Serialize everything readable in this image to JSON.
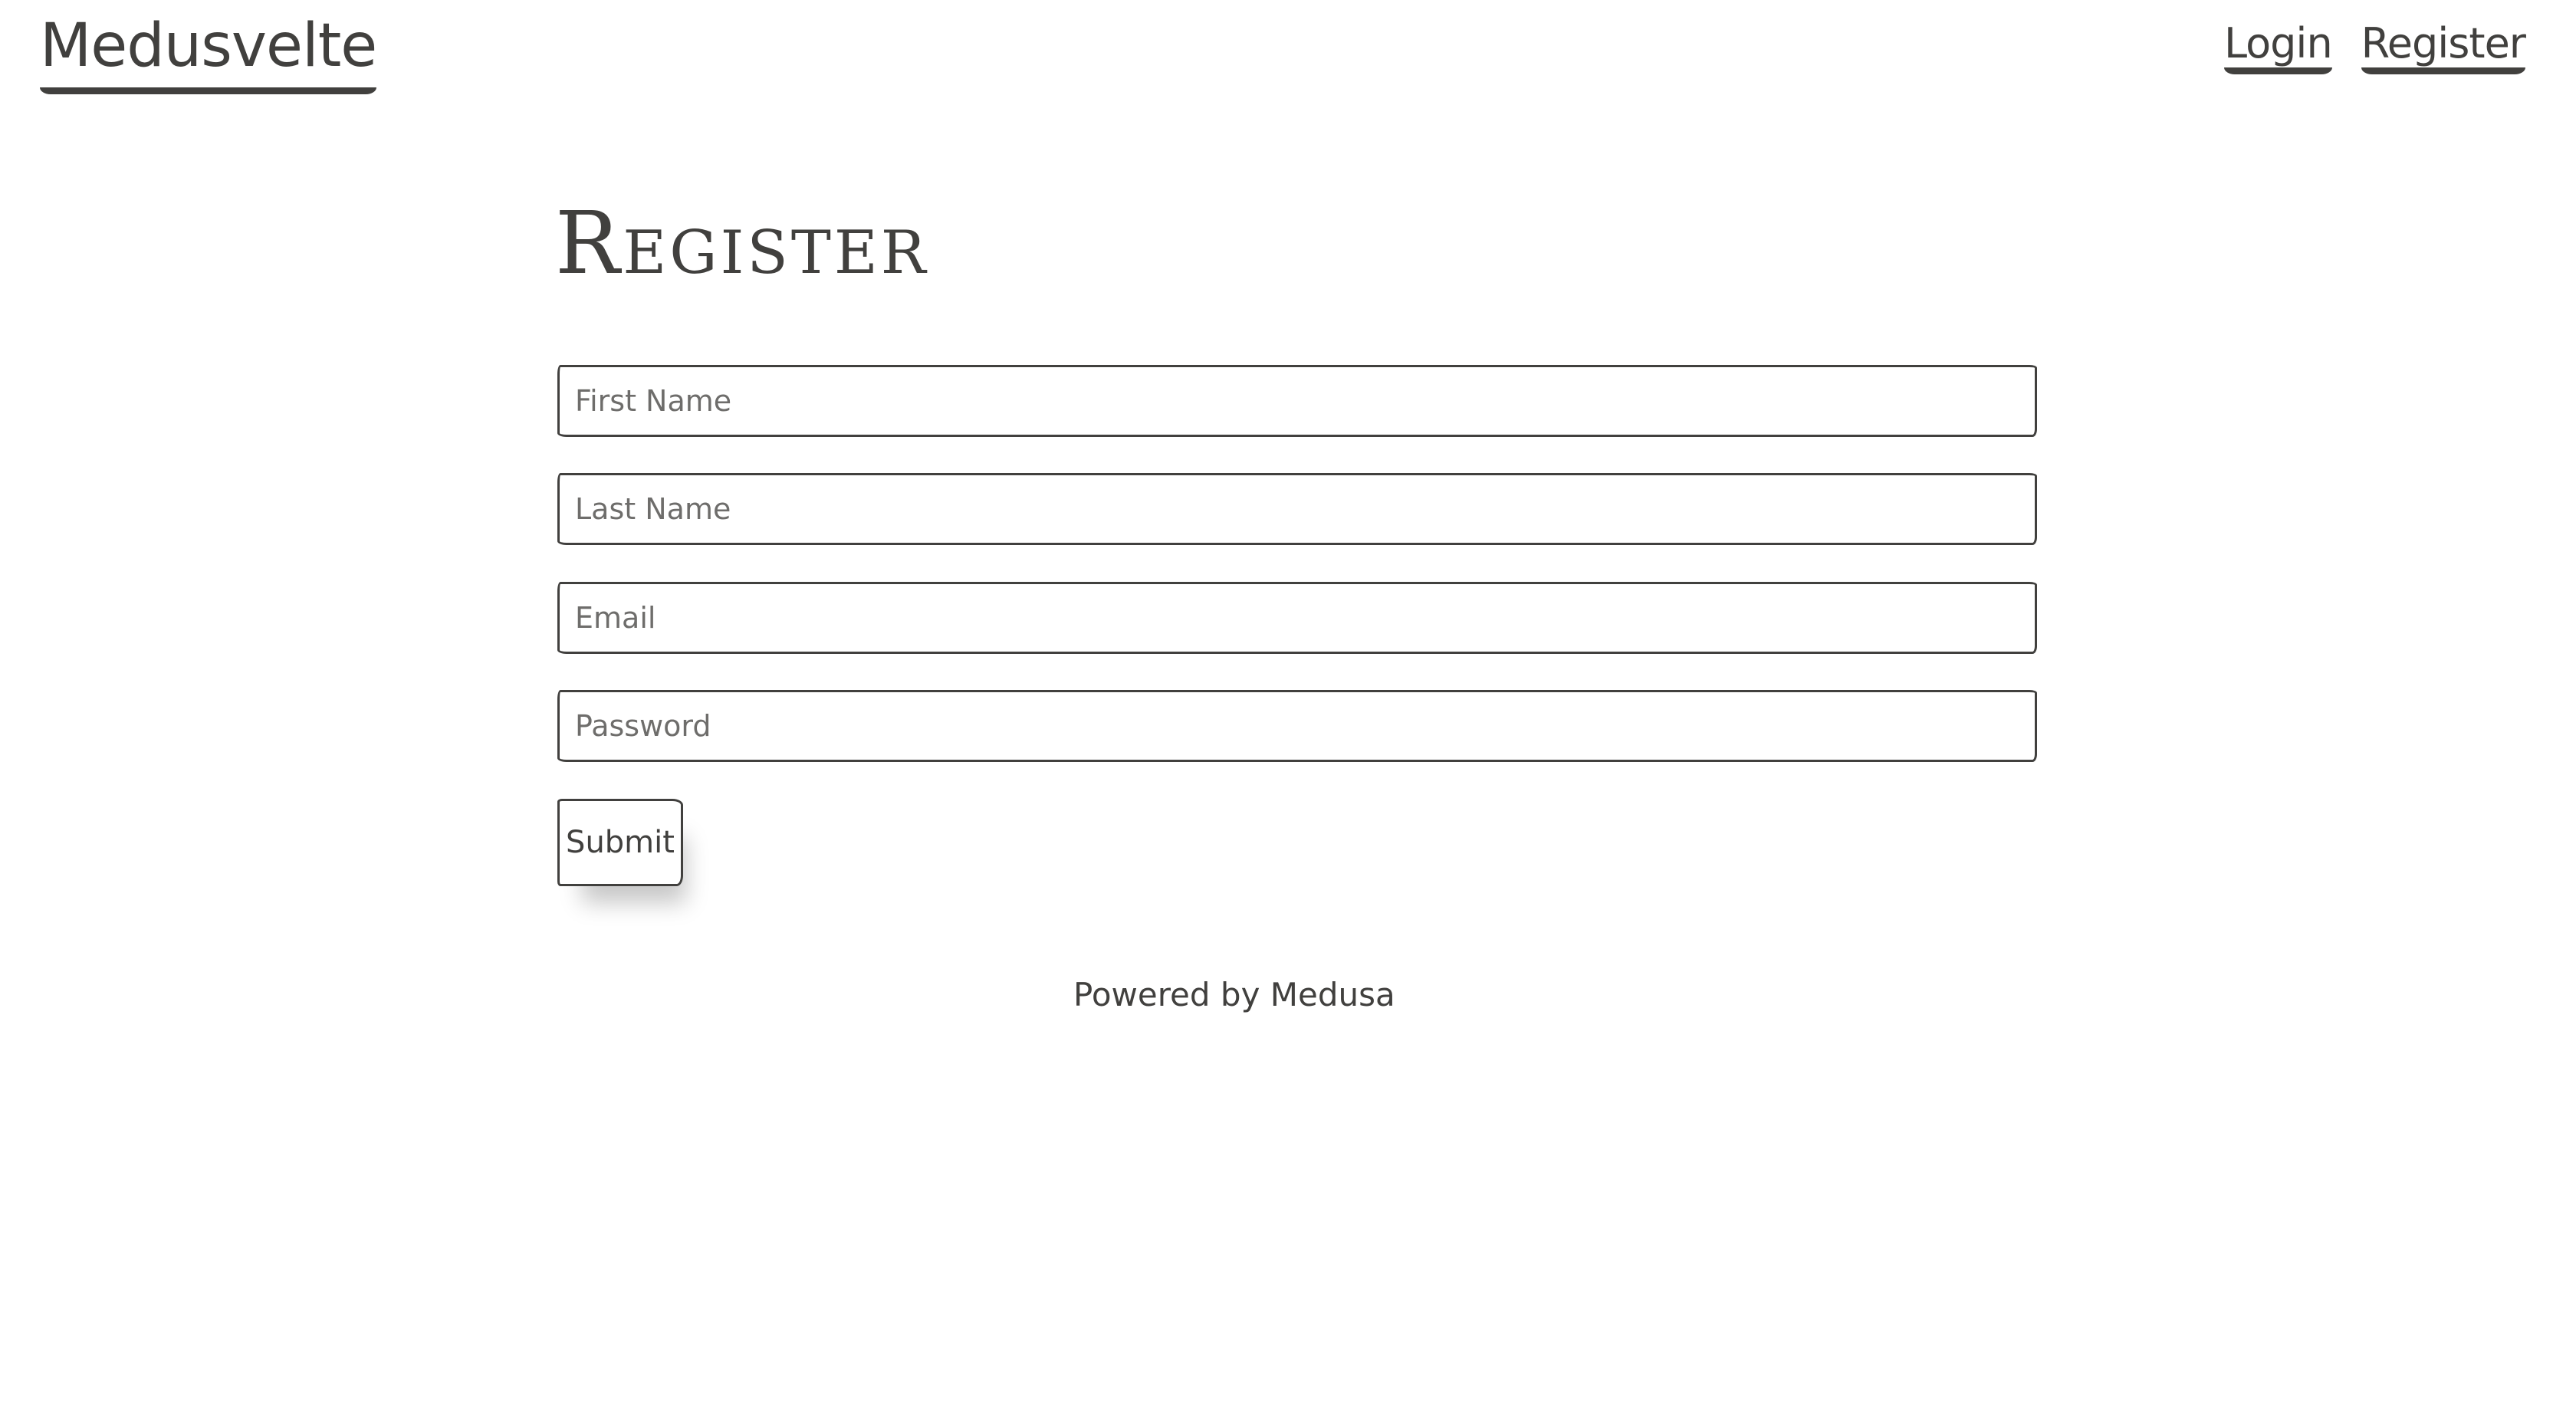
{
  "header": {
    "brand": "Medusvelte",
    "nav": [
      {
        "label": "Login"
      },
      {
        "label": "Register"
      }
    ]
  },
  "main": {
    "title": "Register",
    "form": {
      "first_name": {
        "placeholder": "First Name",
        "value": ""
      },
      "last_name": {
        "placeholder": "Last Name",
        "value": ""
      },
      "email": {
        "placeholder": "Email",
        "value": ""
      },
      "password": {
        "placeholder": "Password",
        "value": ""
      },
      "submit_label": "Submit"
    }
  },
  "footer": {
    "powered_prefix": "Powered by",
    "powered_link": "Medusa"
  },
  "colors": {
    "ink": "#41403e",
    "background": "#ffffff",
    "placeholder": "#6e6d6b"
  }
}
